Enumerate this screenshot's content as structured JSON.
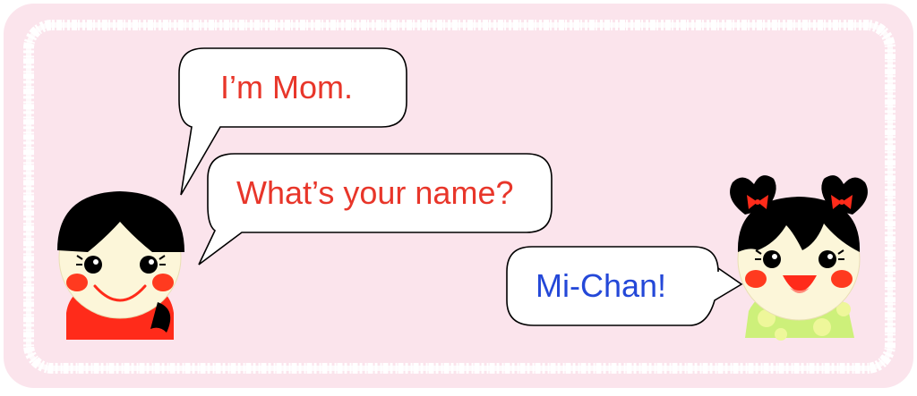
{
  "scene": {
    "background_color": "#fbe4ec",
    "frame_color": "#ffffff"
  },
  "characters": {
    "mom": {
      "name": "mom",
      "hair_color": "#000000",
      "shirt_color": "#ff2b1a"
    },
    "child": {
      "name": "mi-chan",
      "hair_color": "#000000",
      "bow_color": "#ff2b1a",
      "dress_color": "#cdf07a"
    }
  },
  "bubbles": {
    "mom_intro": {
      "text": "I’m Mom.",
      "color": "#e8362a"
    },
    "mom_question": {
      "text": "What’s your name?",
      "color": "#e8362a"
    },
    "child_answer": {
      "text": "Mi-Chan!",
      "color": "#2448d8"
    }
  }
}
